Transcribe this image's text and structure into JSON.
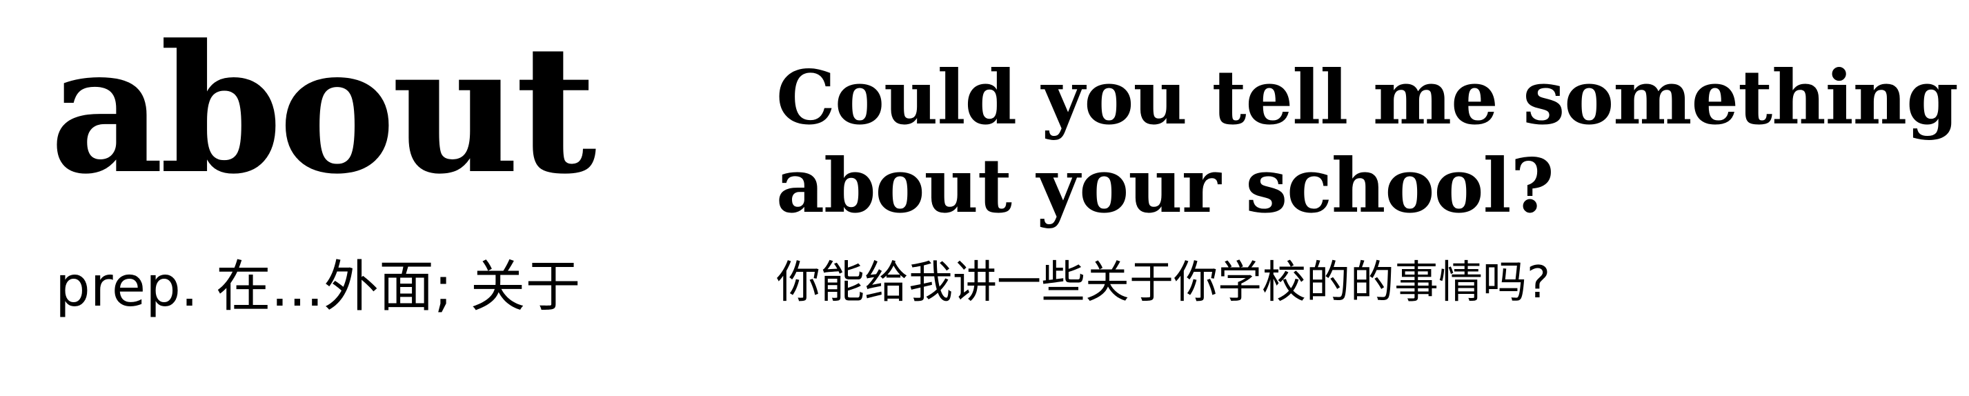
{
  "entry": {
    "word": "about",
    "definition": "prep. 在...外面; 关于"
  },
  "example": {
    "sentence_lines": [
      "Could you tell me something",
      "about your school?"
    ],
    "translation": "你能给我讲一些关于你学校的的事情吗?"
  }
}
